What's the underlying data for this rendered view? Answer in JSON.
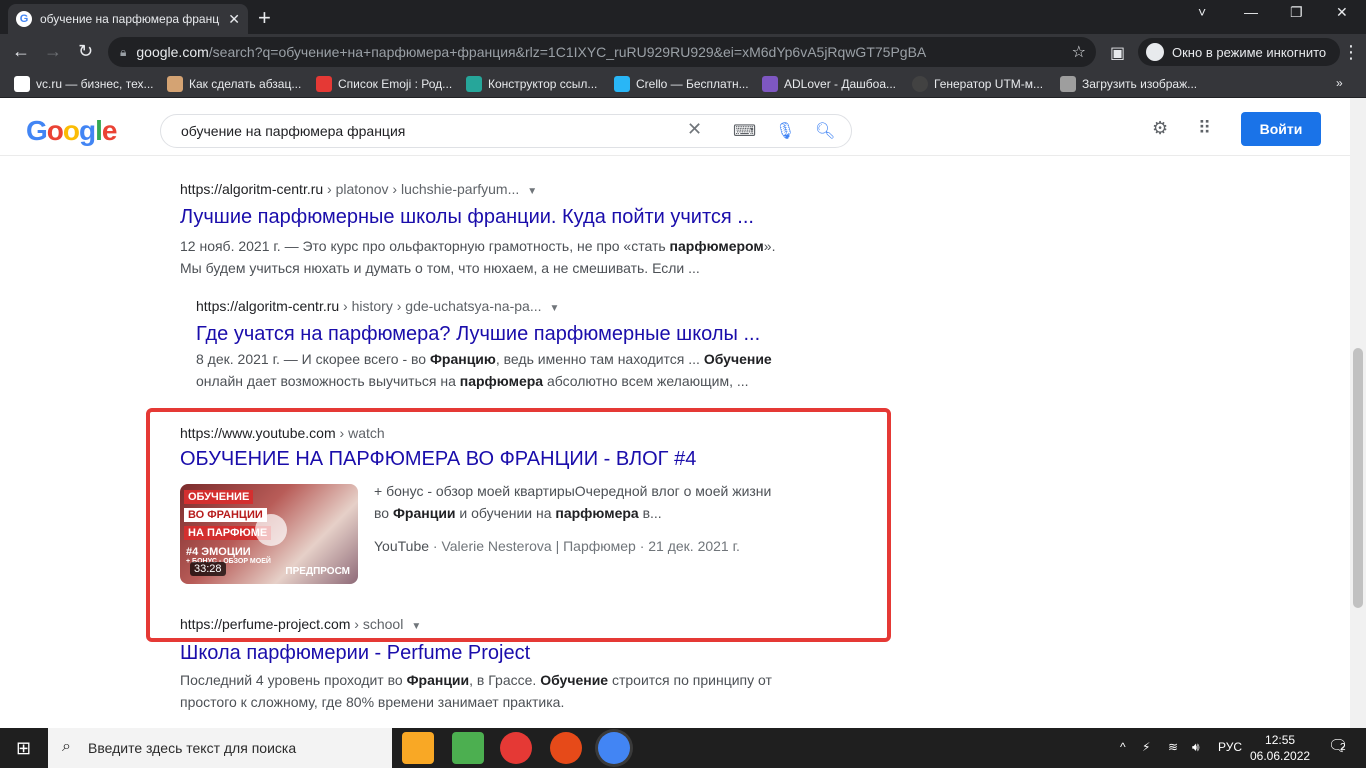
{
  "browser": {
    "tab_title": "обучение на парфюмера франци",
    "tab_favicon": "G",
    "close_glyph": "✕",
    "newtab_glyph": "+",
    "url_host": "google.com",
    "url_rest": "/search?q=обучение+на+парфюмера+франция&rlz=1C1IXYC_ruRU929RU929&ei=xM6dYp6vA5jRqwGT75PgBA",
    "incognito_label": "Окно в режиме инкогнито",
    "window_controls": [
      "˅",
      "—",
      "❐",
      "✕"
    ]
  },
  "bookmarks": [
    {
      "label": "vc.ru — бизнес, тех...",
      "color": "#ffffff"
    },
    {
      "label": "Как сделать абзац...",
      "color": "#d4a373"
    },
    {
      "label": "Список Emoji : Род...",
      "color": "#e53935"
    },
    {
      "label": "Конструктор ссыл...",
      "color": "#26a69a"
    },
    {
      "label": "Crello — Бесплатн...",
      "color": "#29b6f6"
    },
    {
      "label": "ADLover - Дашбоа...",
      "color": "#7e57c2"
    },
    {
      "label": "Генератор UTM-м...",
      "color": "#424242"
    },
    {
      "label": "Загрузить изображ...",
      "color": "#9e9e9e"
    }
  ],
  "google": {
    "logo": "Google",
    "query": "обучение на парфюмера франция",
    "login_label": "Войти"
  },
  "results": [
    {
      "cite_host": "https://algoritm-centr.ru",
      "cite_path": " › platonov › luchshie-parfyum...",
      "title": "Лучшие парфюмерные школы франции. Куда пойти учится ...",
      "snippet_html": "12 нояб. 2021 г. — Это курс про ольфакторную грамотность, не про «стать <b>парфюмером</b>». Мы будем учиться нюхать и думать о том, что нюхаем, а не смешивать. Если ..."
    },
    {
      "cite_host": "https://algoritm-centr.ru",
      "cite_path": " › history › gde-uchatsya-na-pa...",
      "title": "Где учатся на парфюмера? Лучшие парфюмерные школы ...",
      "snippet_html": "8 дек. 2021 г. — И скорее всего - во <b>Францию</b>, ведь именно там находится ... <b>Обучение</b> онлайн дает возможность выучиться на <b>парфюмера</b> абсолютно всем желающим, ..."
    },
    {
      "cite_host": "https://www.youtube.com",
      "cite_path": " › watch",
      "title": "ОБУЧЕНИЕ НА ПАРФЮМЕРА ВО ФРАНЦИИ - ВЛОГ #4",
      "snippet_html": "+ бонус - обзор моей квартирыОчередной влог о моей жизни во <b>Франции</b> и обучении на <b>парфюмера</b> в...",
      "meta_source": "YouTube",
      "meta_rest": " · Valerie Nesterova | Парфюмер · 21 дек. 2021 г.",
      "thumb_line1": "ОБУЧЕНИЕ",
      "thumb_line2": "ВО ФРАНЦИИ",
      "thumb_line3": "НА ПАРФЮМЕ",
      "thumb_sub": "#4 ЭМОЦИИ",
      "thumb_bonus": "+ БОНУС - ОБЗОР МОЕЙ",
      "duration": "33:28",
      "preview": "ПРЕДПРОСМ"
    },
    {
      "cite_host": "https://perfume-project.com",
      "cite_path": " › school",
      "title": "Школа парфюмерии - Perfume Project",
      "snippet_html": "Последний 4 уровень проходит во <b>Франции</b>, в Грассе. <b>Обучение</b> строится по принципу от простого к сложному, где 80% времени занимает практика."
    }
  ],
  "taskbar": {
    "search_placeholder": "Введите здесь текст для поиска",
    "lang": "РУС",
    "time": "12:55",
    "date": "06.06.2022",
    "notif_count": "2"
  }
}
